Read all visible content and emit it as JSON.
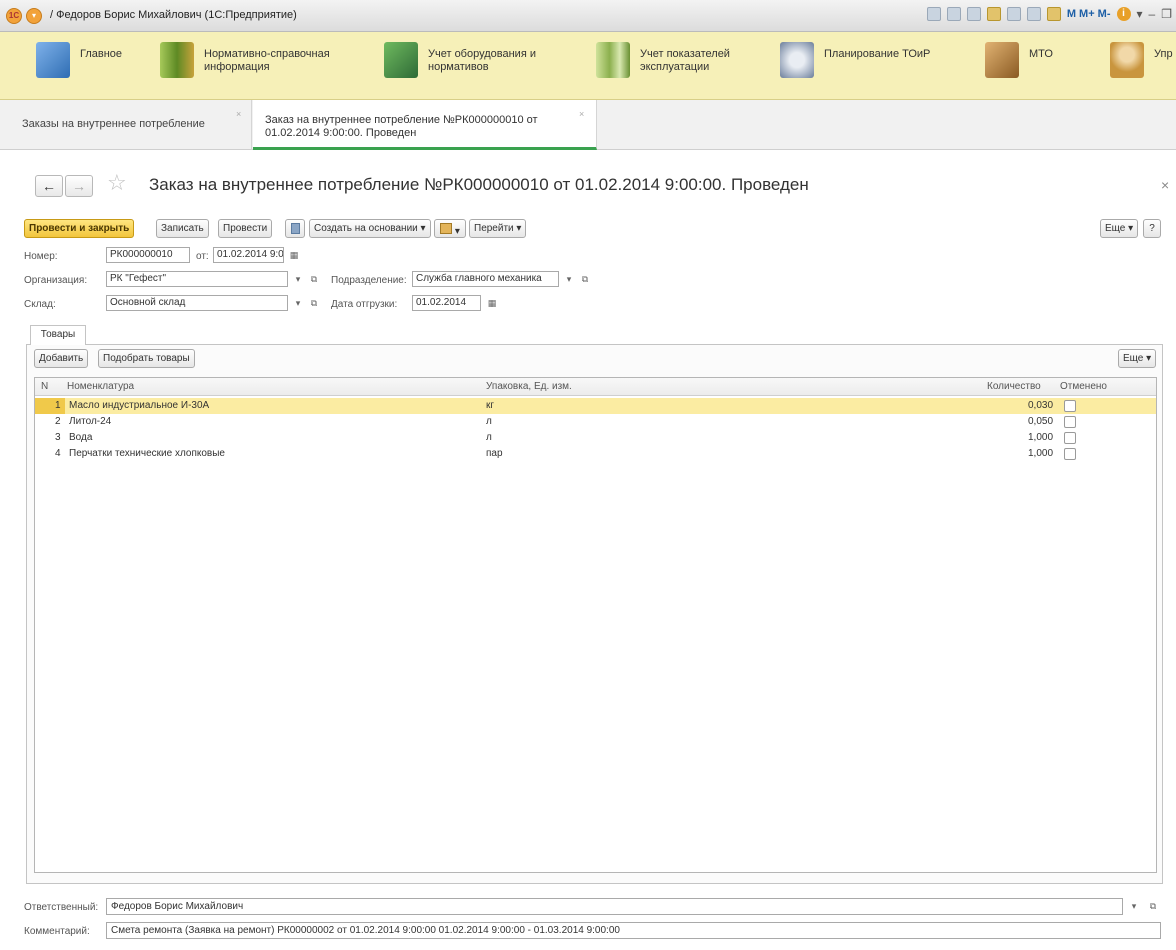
{
  "window": {
    "title": "/ Федоров Борис Михайлович  (1С:Предприятие)",
    "toolbar_text": "M  M+  M-"
  },
  "sections": [
    {
      "label": "Главное",
      "icon": "main-section-icon",
      "color": "#4a8bd6"
    },
    {
      "label": "Нормативно-справочная информация",
      "icon": "binders-icon",
      "color": "#7fa63a"
    },
    {
      "label": "Учет оборудования и нормативов",
      "icon": "equipment-icon",
      "color": "#3f8a4c"
    },
    {
      "label": "Учет показателей эксплуатации",
      "icon": "chart-bars-icon",
      "color": "#8cb04e"
    },
    {
      "label": "Планирование ТОиР",
      "icon": "compass-icon",
      "color": "#6a7d9a"
    },
    {
      "label": "МТО",
      "icon": "boxes-icon",
      "color": "#b07a3c"
    },
    {
      "label": "Упр",
      "icon": "person-icon",
      "color": "#c9953e"
    }
  ],
  "window_tabs": [
    {
      "label": "Заказы на внутреннее потребление",
      "active": false
    },
    {
      "label_line1": "Заказ на внутреннее потребление №РК000000010 от",
      "label_line2": "01.02.2014 9:00:00. Проведен",
      "active": true
    }
  ],
  "form": {
    "title": "Заказ на внутреннее потребление №РК000000010 от 01.02.2014 9:00:00. Проведен",
    "commands": {
      "post_close": "Провести и закрыть",
      "save": "Записать",
      "post": "Провести",
      "create_based": "Создать на основании",
      "go_to": "Перейти",
      "more": "Еще",
      "help": "?"
    },
    "fields": {
      "number_label": "Номер:",
      "number": "РК000000010",
      "date_label": "от:",
      "date": "01.02.2014  9:00:0(",
      "org_label": "Организация:",
      "org": "РК \"Гефест\"",
      "dept_label": "Подразделение:",
      "dept": "Служба главного механика",
      "warehouse_label": "Склад:",
      "warehouse": "Основной склад",
      "ship_date_label": "Дата отгрузки:",
      "ship_date": "01.02.2014"
    },
    "tabs": {
      "goods": "Товары"
    },
    "goods": {
      "add": "Добавить",
      "pick": "Подобрать товары",
      "more": "Еще",
      "columns": {
        "n": "N",
        "item": "Номенклатура",
        "unit": "Упаковка, Ед. изм.",
        "qty": "Количество",
        "cancelled": "Отменено"
      },
      "rows": [
        {
          "n": "1",
          "item": "Масло индустриальное И-30А",
          "unit": "кг",
          "qty": "0,030",
          "cancelled": false
        },
        {
          "n": "2",
          "item": "Литол-24",
          "unit": "л",
          "qty": "0,050",
          "cancelled": false
        },
        {
          "n": "3",
          "item": "Вода",
          "unit": "л",
          "qty": "1,000",
          "cancelled": false
        },
        {
          "n": "4",
          "item": "Перчатки технические хлопковые",
          "unit": "пар",
          "qty": "1,000",
          "cancelled": false
        }
      ]
    },
    "responsible_label": "Ответственный:",
    "responsible": "Федоров Борис Михайлович",
    "comment_label": "Комментарий:",
    "comment": "Смета ремонта (Заявка на ремонт) РК00000002 от 01.02.2014 9:00:00  01.02.2014 9:00:00 - 01.03.2014 9:00:00"
  }
}
